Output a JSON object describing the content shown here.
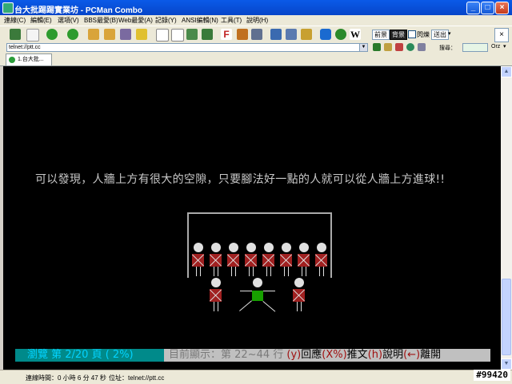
{
  "window": {
    "title": "台大批踢踢實業坊 - PCMan Combo",
    "minimize": "_",
    "maximize": "□",
    "close": "×"
  },
  "menu": [
    "連線(C)",
    "編輯(E)",
    "選項(V)",
    "BBS最愛(B)",
    "Web最愛(A)",
    "記錄(Y)",
    "ANSI編輯(N)",
    "工具(T)",
    "說明(H)"
  ],
  "toolbar": {
    "front_label": "前景",
    "back_label": "背景",
    "blink_label": "閃爍",
    "send_label": "送出"
  },
  "address": {
    "value": "telnet://ptt.cc",
    "search_placeholder": "搜尋：",
    "engine": "Orz"
  },
  "tabs": [
    {
      "label": "1.台大批..."
    }
  ],
  "terminal": {
    "message": "可以發現，人牆上方有很大的空隙，只要腳法好一點的人就可以從人牆上方進球!!",
    "status_left": "瀏覽 第 2/20 頁 (  2%)",
    "status_mid": "目前顯示：第 22~44 行",
    "status_reply_key": "(y)",
    "status_reply": "回應",
    "status_push_key": "(X%)",
    "status_push": "推文",
    "status_help_key": "(h)",
    "status_help": "說明",
    "status_leave_key": "(←)",
    "status_leave": "離開"
  },
  "statusbar": {
    "time": "連線時間：0 小時 6 分 47 秒",
    "address": "位址：telnet://ptt.cc"
  },
  "badge": "#99420",
  "colors": {
    "titlebar": "#0645c9",
    "terminal_bg": "#000000",
    "wall_body": "#a02020",
    "shooter_body": "#17a000"
  }
}
